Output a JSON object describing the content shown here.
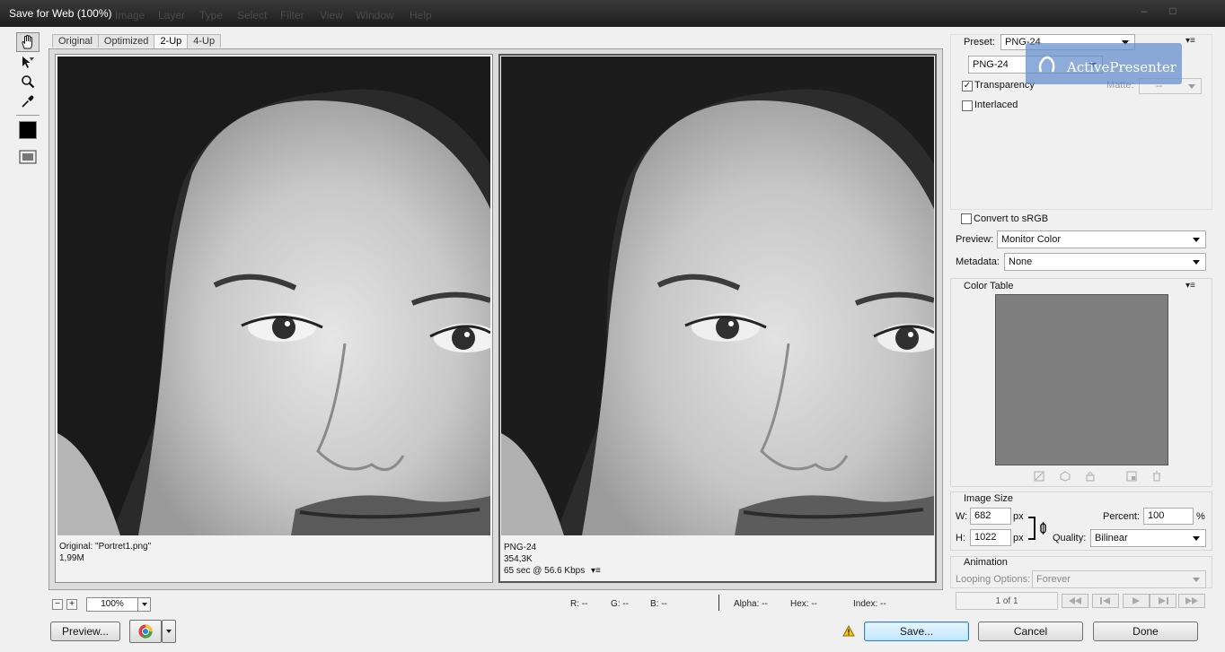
{
  "window": {
    "title": "Save for Web (100%)",
    "background_menu": [
      "Image",
      "Layer",
      "Type",
      "Select",
      "Filter",
      "View",
      "Window",
      "Help"
    ],
    "minimize_glyph": "–",
    "maximize_glyph": "□"
  },
  "tabs": [
    "Original",
    "Optimized",
    "2-Up",
    "4-Up"
  ],
  "active_tab": "2-Up",
  "tools": [
    "hand-icon",
    "slice-select-icon",
    "zoom-icon",
    "eyedropper-icon",
    "eyedropper-color-swatch",
    "toggle-slices-icon"
  ],
  "eyedropper_color": "#000000",
  "panes": {
    "left": {
      "line1": "Original: \"Portret1.png\"",
      "line2": "1,99M"
    },
    "right": {
      "line1": "PNG-24",
      "line2": "354,3K",
      "line3": "65 sec @ 56.6 Kbps"
    }
  },
  "zoom": {
    "minus": "−",
    "plus": "+",
    "value": "100%"
  },
  "readouts": {
    "r": "R: --",
    "g": "G: --",
    "b": "B: --",
    "alpha": "Alpha: --",
    "hex": "Hex: --",
    "index": "Index: --"
  },
  "buttons": {
    "preview": "Preview...",
    "save": "Save...",
    "cancel": "Cancel",
    "done": "Done"
  },
  "settings": {
    "preset_label": "Preset:",
    "preset_value": "PNG-24",
    "format_value": "PNG-24",
    "transparency_label": "Transparency",
    "transparency_checked": true,
    "interlaced_label": "Interlaced",
    "interlaced_checked": false,
    "matte_label": "Matte:",
    "matte_value": "--",
    "convert_srgb_label": "Convert to sRGB",
    "convert_srgb_checked": false,
    "preview_label": "Preview:",
    "preview_value": "Monitor Color",
    "metadata_label": "Metadata:",
    "metadata_value": "None",
    "check_glyph": "✓",
    "menu_glyph": "▾≡"
  },
  "color_table": {
    "title": "Color Table",
    "swatch_color": "#7f7f7f"
  },
  "image_size": {
    "title": "Image Size",
    "w_label": "W:",
    "w_value": "682",
    "w_unit": "px",
    "h_label": "H:",
    "h_value": "1022",
    "h_unit": "px",
    "percent_label": "Percent:",
    "percent_value": "100",
    "percent_unit": "%",
    "quality_label": "Quality:",
    "quality_value": "Bilinear"
  },
  "animation": {
    "title": "Animation",
    "looping_label": "Looping Options:",
    "looping_value": "Forever",
    "frame_counter": "1 of 1"
  },
  "watermark": {
    "text": "ActivePresenter"
  }
}
